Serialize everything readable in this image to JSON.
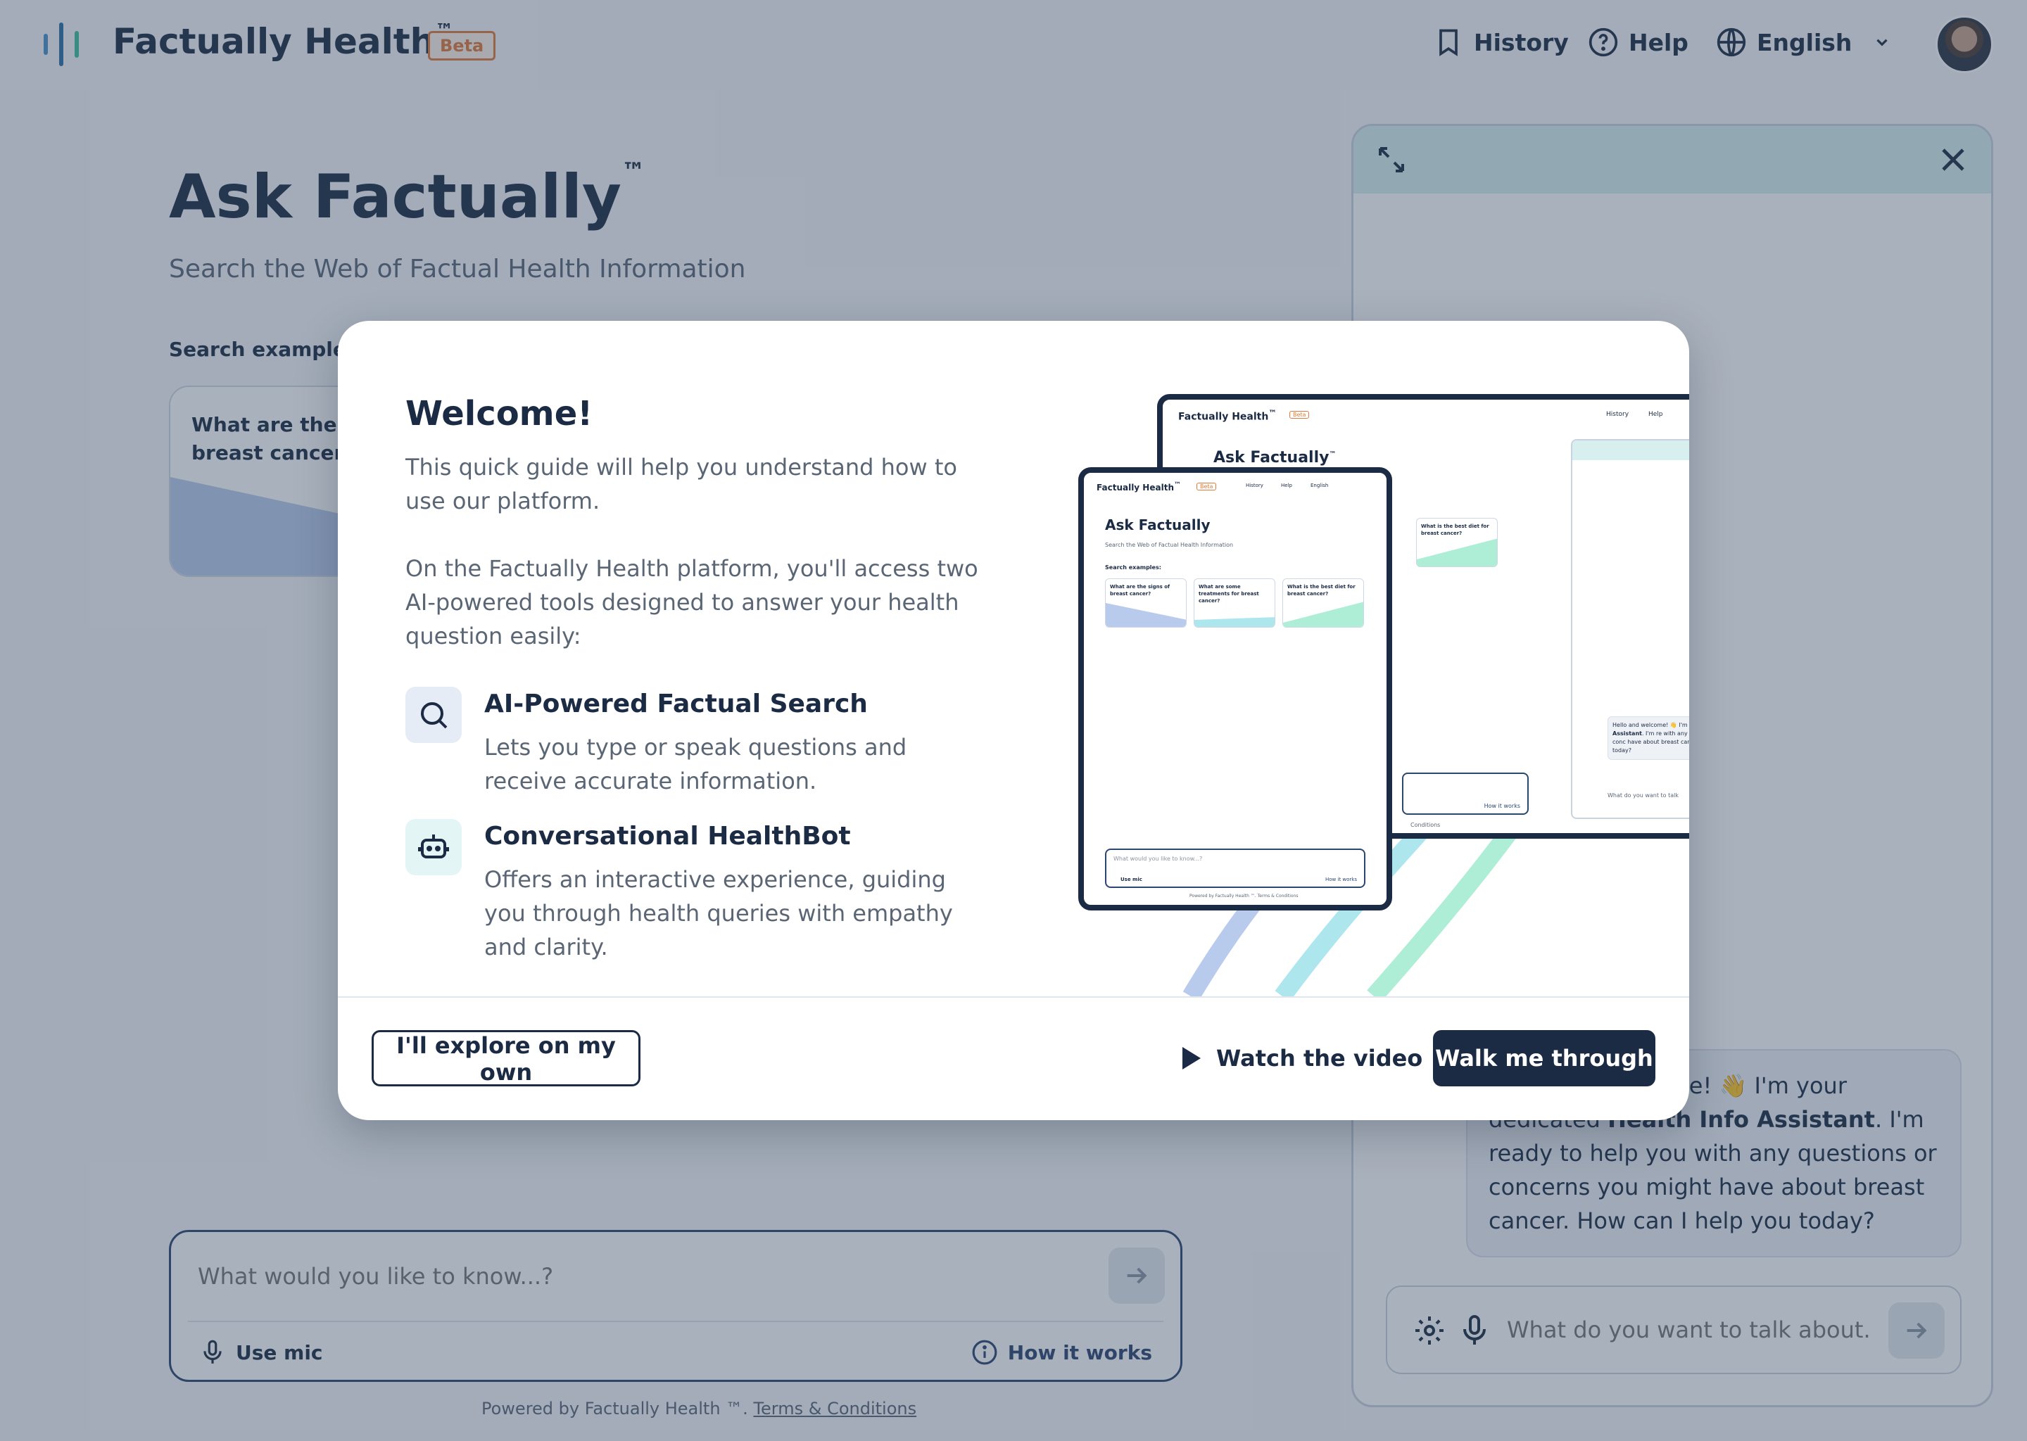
{
  "header": {
    "brand": "Factually Health",
    "brand_tm": "™",
    "beta": "Beta",
    "nav": {
      "history": "History",
      "help": "Help",
      "language": "English"
    }
  },
  "main": {
    "title": "Ask Factually",
    "title_tm": "™",
    "subtitle": "Search the Web of Factual Health Information",
    "examples_label": "Search examples:",
    "examples": [
      {
        "question": "What are the signs of breast cancer?"
      }
    ],
    "search": {
      "placeholder": "What would you like to know...?",
      "use_mic": "Use mic",
      "how_it_works": "How it works"
    },
    "footer": {
      "powered_by": "Powered by Factually Health ™.",
      "terms": "Terms & Conditions"
    }
  },
  "chat": {
    "message_prefix": "Hello and welcome! 👋 I'm your dedicated ",
    "message_bold": "Health Info Assistant",
    "message_suffix": ". I'm ready to help you with any questions or concerns you might have about breast cancer. How can I help you today?",
    "input_placeholder": "What do you want to talk about...?"
  },
  "modal": {
    "title": "Welcome!",
    "intro": "This quick guide will help you understand how to use our platform.",
    "body": "On the Factually Health platform, you'll access two AI-powered tools designed to answer your health question easily:",
    "features": [
      {
        "icon": "search-icon",
        "title": "AI-Powered Factual Search",
        "description": "Lets you type or speak questions and receive accurate information."
      },
      {
        "icon": "robot-icon",
        "title": "Conversational HealthBot",
        "description": "Offers an interactive experience, guiding you through health queries with empathy and clarity."
      }
    ],
    "buttons": {
      "explore": "I'll explore on my own",
      "video": "Watch the video",
      "walk": "Walk me through"
    },
    "illustration": {
      "brand": "Factually Health",
      "tm": "™",
      "beta": "Beta",
      "nav_history": "History",
      "nav_help": "Help",
      "nav_language": "English",
      "title": "Ask Factually",
      "subtitle": "Search the Web of Factual Health Information",
      "examples_label": "Search examples:",
      "cards": [
        "What are the signs of breast cancer?",
        "What are some treatments for breast cancer?",
        "What is the best diet for breast cancer?"
      ],
      "input_placeholder": "What would you like to know...?",
      "use_mic": "Use mic",
      "how_it_works": "How it works",
      "footer": "Powered by Factually Health ™. Terms & Conditions",
      "terms_fragment": "Conditions",
      "chat_msg_1": "Hello and welcome! 👋 I'm y",
      "chat_msg_bold": "Health Info Assistant",
      "chat_msg_2": ". I'm re with any questions or conc have about breast cancer. H you today?",
      "chat_placeholder": "What do you want to talk"
    }
  },
  "colors": {
    "navy": "#1c2b44",
    "beta_orange": "#e07a3a",
    "arc_blue": "#b9cbec",
    "arc_cyan": "#aee6ee",
    "arc_green": "#aeeed6"
  }
}
